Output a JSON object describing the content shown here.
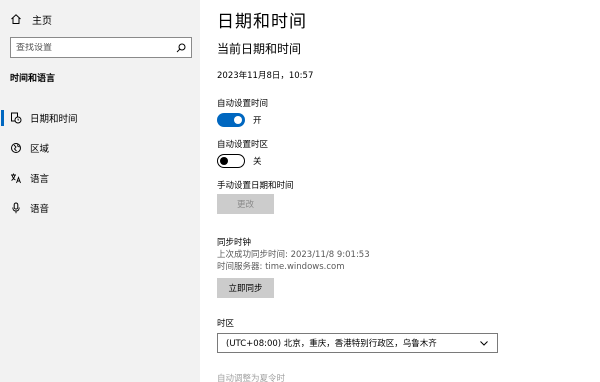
{
  "sidebar": {
    "home_label": "主页",
    "search_placeholder": "查找设置",
    "section_title": "时间和语言",
    "items": [
      {
        "label": "日期和时间",
        "icon": "clock-icon",
        "selected": true
      },
      {
        "label": "区域",
        "icon": "globe-icon",
        "selected": false
      },
      {
        "label": "语言",
        "icon": "language-icon",
        "selected": false
      },
      {
        "label": "语音",
        "icon": "microphone-icon",
        "selected": false
      }
    ]
  },
  "main": {
    "page_title": "日期和时间",
    "subtitle": "当前日期和时间",
    "current_datetime": "2023年11月8日，10:57",
    "auto_time": {
      "label": "自动设置时间",
      "state_label": "开",
      "on": true
    },
    "auto_timezone": {
      "label": "自动设置时区",
      "state_label": "关",
      "on": false
    },
    "manual": {
      "label": "手动设置日期和时间",
      "button_label": "更改"
    },
    "sync": {
      "title": "同步时钟",
      "last_sync": "上次成功同步时间: 2023/11/8 9:01:53",
      "server": "时间服务器: time.windows.com",
      "button_label": "立即同步"
    },
    "timezone": {
      "label": "时区",
      "value": "(UTC+08:00) 北京，重庆，香港特别行政区，乌鲁木齐"
    },
    "dst_label": "自动调整为夏令时"
  },
  "colors": {
    "accent": "#0067c0",
    "sidebar_bg": "#f2f2f2",
    "button_bg": "#cccccc"
  }
}
